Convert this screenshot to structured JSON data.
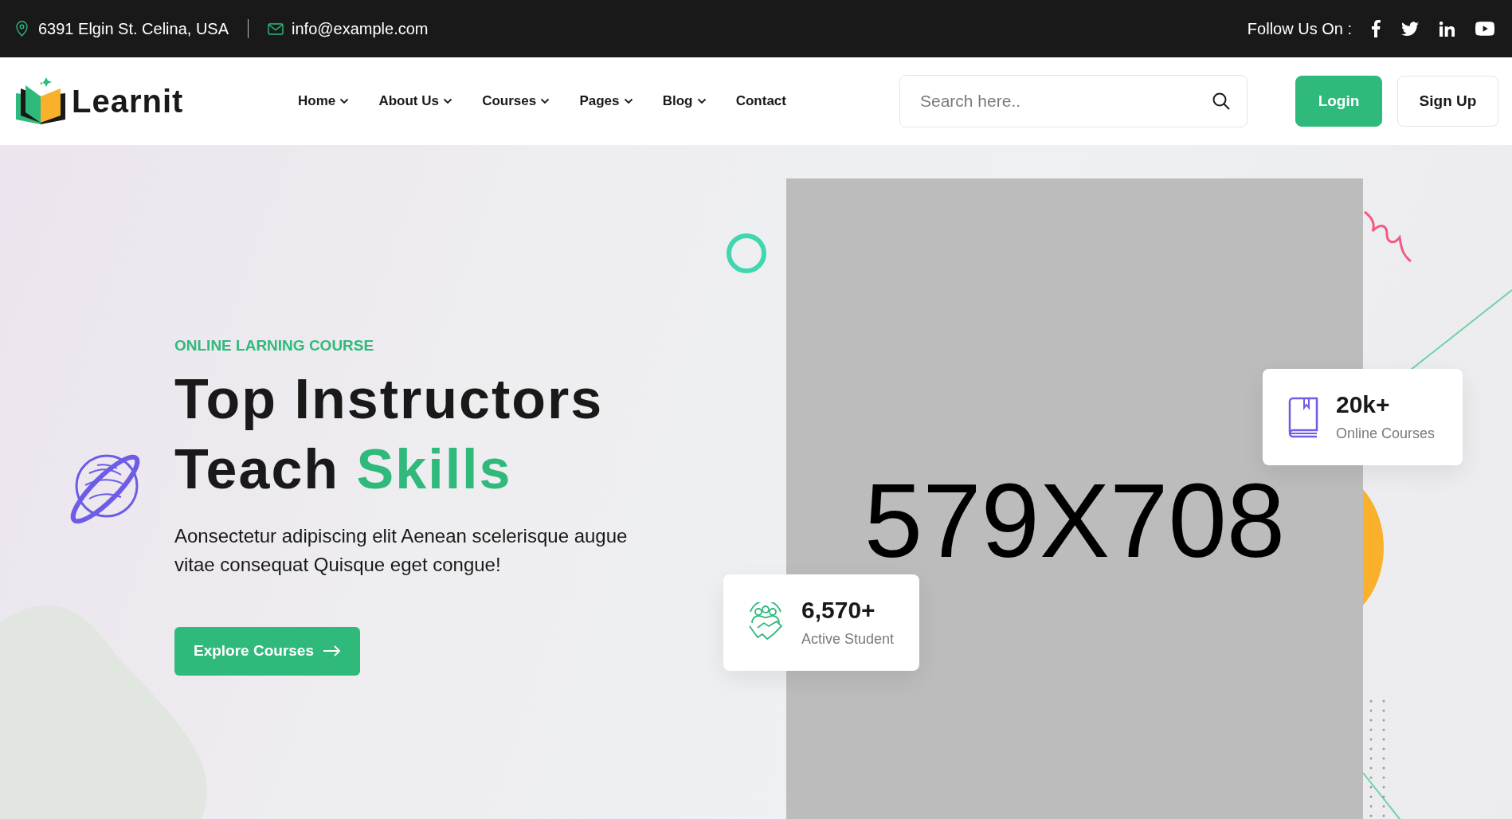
{
  "top_bar": {
    "address": "6391 Elgin St. Celina, USA",
    "email": "info@example.com",
    "follow_label": "Follow Us On :",
    "social": [
      {
        "kind": "facebook"
      },
      {
        "kind": "twitter"
      },
      {
        "kind": "linkedin"
      },
      {
        "kind": "youtube"
      }
    ]
  },
  "header": {
    "logo": "Learnit",
    "nav": [
      {
        "label": "Home",
        "dropdown": true
      },
      {
        "label": "About Us",
        "dropdown": true
      },
      {
        "label": "Courses",
        "dropdown": true
      },
      {
        "label": "Pages",
        "dropdown": true
      },
      {
        "label": "Blog",
        "dropdown": true
      },
      {
        "label": "Contact",
        "dropdown": false
      }
    ],
    "search": {
      "placeholder": "Search here.."
    },
    "buttons": [
      {
        "label": "Login",
        "kind": "primary"
      },
      {
        "label": "Sign Up",
        "kind": "outline"
      }
    ]
  },
  "hero": {
    "eyebrow": "ONLINE LARNING COURSE",
    "title_line_1": "Top Instructors",
    "title_line_2": "Teach **Skills**",
    "description": "Aonsectetur adipiscing elit Aenean scelerisque augue vitae consequat Quisque eget congue!",
    "cta": "Explore Courses",
    "image_placeholder": "579X708",
    "stats": [
      {
        "kind": "courses",
        "value": "20k+",
        "label": "Online Courses"
      },
      {
        "kind": "students",
        "value": "6,570+",
        "label": "Active Student"
      }
    ]
  }
}
